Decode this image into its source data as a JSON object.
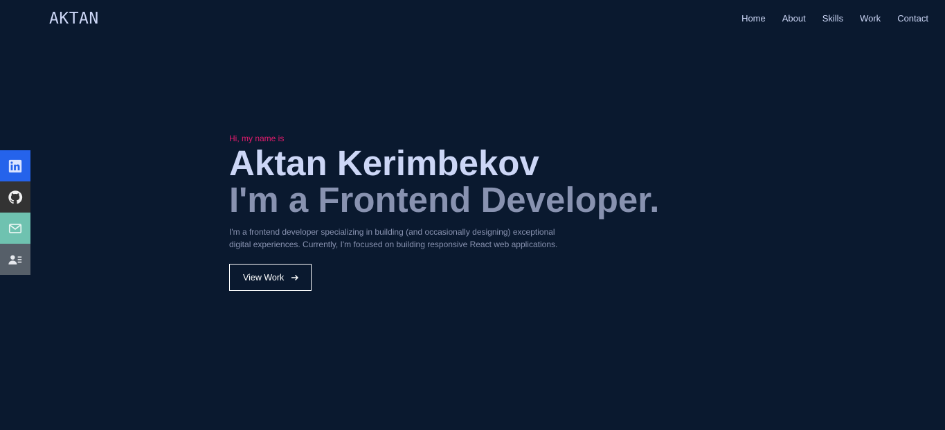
{
  "header": {
    "logo": "AKTAN",
    "nav": [
      "Home",
      "About",
      "Skills",
      "Work",
      "Contact"
    ]
  },
  "social": [
    {
      "icon": "linkedin-icon",
      "color": "#2563eb"
    },
    {
      "icon": "github-icon",
      "color": "#333333"
    },
    {
      "icon": "mail-icon",
      "color": "#6fc2b0"
    },
    {
      "icon": "resume-icon",
      "color": "#565f69"
    }
  ],
  "hero": {
    "greeting": "Hi, my name is",
    "name": "Aktan Kerimbekov",
    "role": "I'm a Frontend Developer.",
    "description_line1": "I'm a frontend developer specializing in building (and occasionally designing) exceptional",
    "description_line2": "digital experiences. Currently, I'm focused on building responsive React web applications.",
    "cta_label": "View Work"
  },
  "colors": {
    "background": "#0a192f",
    "accent": "#e31b6d",
    "heading": "#ccd6f6",
    "muted": "#8892b0"
  }
}
